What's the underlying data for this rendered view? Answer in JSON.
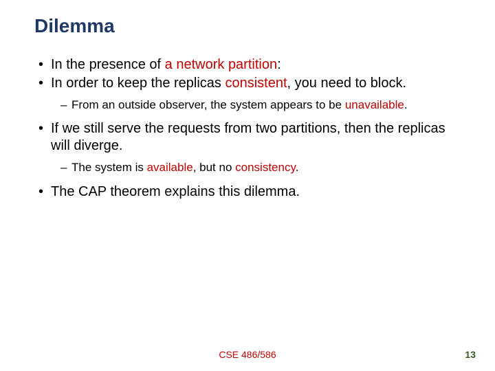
{
  "title": "Dilemma",
  "b1a_pre": "In the presence of ",
  "b1a_hl": "a network partition",
  "b1a_post": ":",
  "b1b_pre": "In order to keep the replicas ",
  "b1b_hl": "consistent",
  "b1b_post": ", you need to block.",
  "b1c_pre": "From an outside observer, the system appears to be ",
  "b1c_hl": "unavailable",
  "b1c_post": ".",
  "b2a": "If we still serve the requests from two partitions, then the replicas will diverge.",
  "b2b_pre": "The system is ",
  "b2b_hl1": "available",
  "b2b_mid": ", but no ",
  "b2b_hl2": "consistency",
  "b2b_post": ".",
  "b3a": "The CAP theorem explains this dilemma.",
  "footer_center": "CSE 486/586",
  "footer_right": "13"
}
